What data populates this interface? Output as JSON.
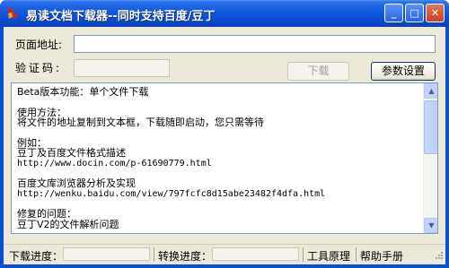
{
  "window": {
    "title": "易读文档下载器--同时支持百度/豆丁",
    "minimize_icon": "minimize-icon",
    "maximize_icon": "maximize-icon",
    "close_icon": "close-icon"
  },
  "form": {
    "address_label": "页面地址:",
    "address_value": "",
    "code_label": "验证码:",
    "code_value": "",
    "download_button": "下载",
    "settings_button": "参数设置"
  },
  "content_lines": [
    {
      "text": "Beta版本功能：单个文件下载"
    },
    {
      "gap": true
    },
    {
      "text": "使用方法："
    },
    {
      "text": "将文件的地址复制到文本框，下载随即启动，您只需等待"
    },
    {
      "gap": true
    },
    {
      "text": "例如："
    },
    {
      "text": "豆丁及百度文件格式描述"
    },
    {
      "text": "http://www.docin.com/p-61690779.html",
      "mono": true
    },
    {
      "gap": true
    },
    {
      "text": "百度文库浏览器分析及实现"
    },
    {
      "text": "http://wenku.baidu.com/view/797fcfc8d15abe23482f4dfa.html",
      "mono": true
    },
    {
      "gap": true
    },
    {
      "text": "修复的问题："
    },
    {
      "text": "豆丁V2的文件解析问题"
    }
  ],
  "status": {
    "download_progress_label": "下载进度：",
    "download_progress": 0,
    "convert_progress_label": "转换进度：",
    "convert_progress": 0,
    "tool_principle": "工具原理",
    "help_manual": "帮助手册"
  }
}
